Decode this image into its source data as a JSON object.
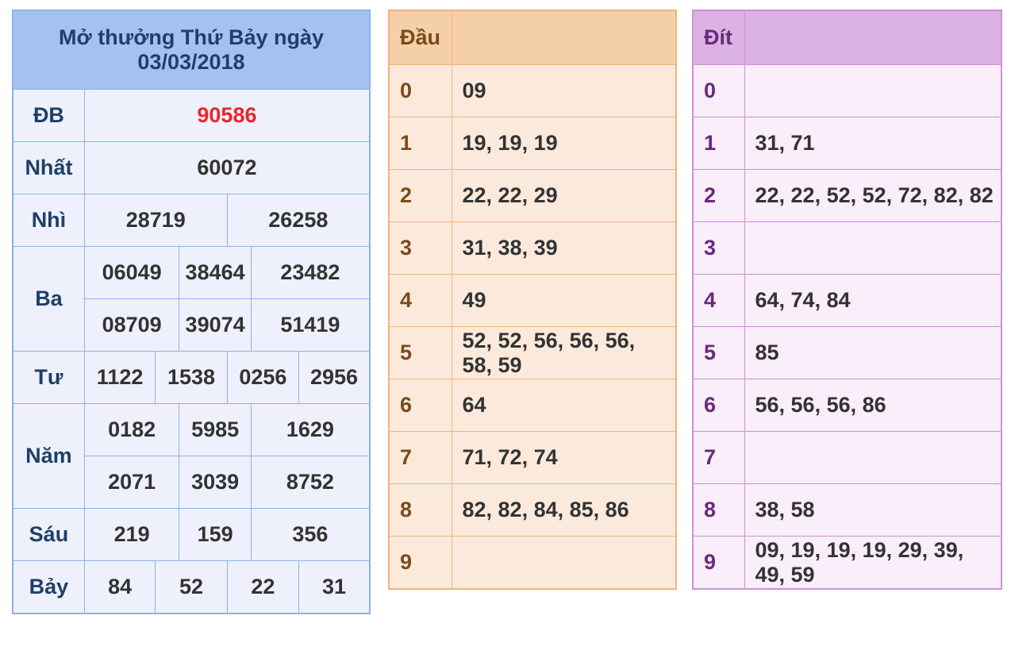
{
  "results": {
    "title": "Mở thưởng Thứ Bảy ngày 03/03/2018",
    "rows": {
      "db": {
        "label": "ĐB",
        "values": [
          "90586"
        ]
      },
      "nhat": {
        "label": "Nhất",
        "values": [
          "60072"
        ]
      },
      "nhi": {
        "label": "Nhì",
        "values": [
          "28719",
          "26258"
        ]
      },
      "ba": {
        "label": "Ba",
        "values": [
          "06049",
          "38464",
          "23482",
          "08709",
          "39074",
          "51419"
        ]
      },
      "tu": {
        "label": "Tư",
        "values": [
          "1122",
          "1538",
          "0256",
          "2956"
        ]
      },
      "nam": {
        "label": "Năm",
        "values": [
          "0182",
          "5985",
          "1629",
          "2071",
          "3039",
          "8752"
        ]
      },
      "sau": {
        "label": "Sáu",
        "values": [
          "219",
          "159",
          "356"
        ]
      },
      "bay": {
        "label": "Bảy",
        "values": [
          "84",
          "52",
          "22",
          "31"
        ]
      }
    }
  },
  "dau": {
    "header": "Đầu",
    "header_value": "",
    "rows": [
      {
        "digit": "0",
        "values": "09"
      },
      {
        "digit": "1",
        "values": "19, 19, 19"
      },
      {
        "digit": "2",
        "values": "22, 22, 29"
      },
      {
        "digit": "3",
        "values": "31, 38, 39"
      },
      {
        "digit": "4",
        "values": "49"
      },
      {
        "digit": "5",
        "values": "52, 52, 56, 56, 56, 58, 59"
      },
      {
        "digit": "6",
        "values": "64"
      },
      {
        "digit": "7",
        "values": "71, 72, 74"
      },
      {
        "digit": "8",
        "values": "82, 82, 84, 85, 86"
      },
      {
        "digit": "9",
        "values": ""
      }
    ]
  },
  "dit": {
    "header": "Đít",
    "header_value": "",
    "rows": [
      {
        "digit": "0",
        "values": ""
      },
      {
        "digit": "1",
        "values": "31, 71"
      },
      {
        "digit": "2",
        "values": "22, 22, 52, 52, 72, 82, 82"
      },
      {
        "digit": "3",
        "values": ""
      },
      {
        "digit": "4",
        "values": "64, 74, 84"
      },
      {
        "digit": "5",
        "values": "85"
      },
      {
        "digit": "6",
        "values": "56, 56, 56, 86"
      },
      {
        "digit": "7",
        "values": ""
      },
      {
        "digit": "8",
        "values": "38, 58"
      },
      {
        "digit": "9",
        "values": "09, 19, 19, 19, 29, 39, 49, 59"
      }
    ]
  },
  "colors": {
    "special_prize": "#e8262b",
    "results_border": "#8fb1e8",
    "dau_border": "#f1b47a",
    "dit_border": "#cf8fd8"
  }
}
